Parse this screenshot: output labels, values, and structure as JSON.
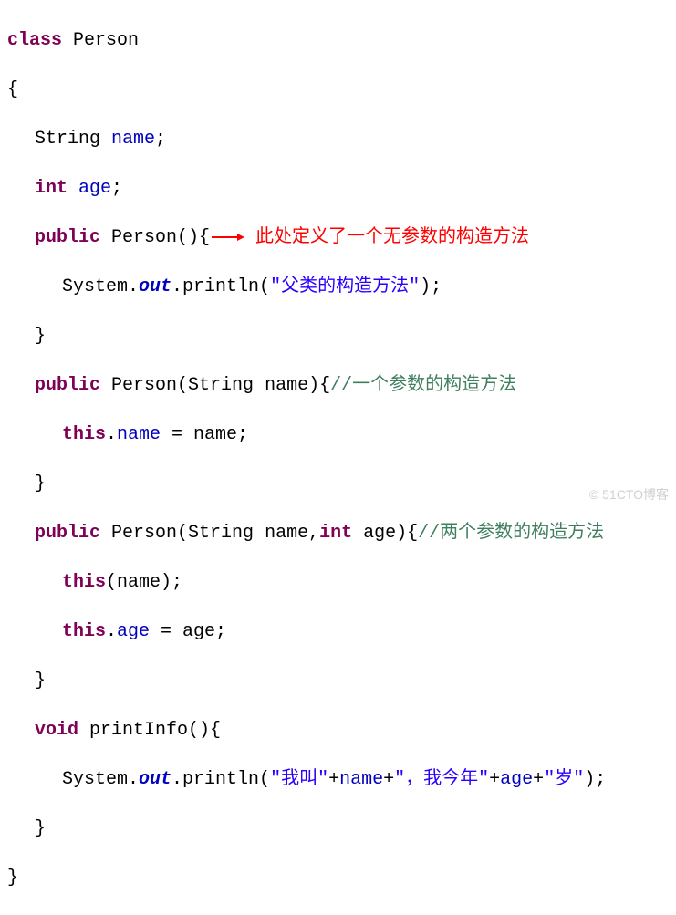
{
  "code": {
    "l1_kw": "class",
    "l1_name": " Person",
    "l2": "{",
    "l3_type": "String",
    "l3_var": " name",
    "l3_semi": ";",
    "l4_type": "int",
    "l4_var": " age",
    "l4_semi": ";",
    "l5_kw": "public",
    "l5_name": " Person",
    "l5_paren": "(){",
    "l5_anno": " 此处定义了一个无参数的构造方法",
    "l6_sys": "System.",
    "l6_out": "out",
    "l6_print": ".println(",
    "l6_str": "\"父类的构造方法\"",
    "l6_end": ");",
    "l7": "}",
    "l8_kw": "public",
    "l8_name": " Person",
    "l8_paren_open": "(String name){",
    "l8_paren_open_pre": "(",
    "l8_param_type": "String",
    "l8_param_name": " name",
    "l8_paren_close": "){",
    "l8_comment": "//一个参数的构造方法",
    "l9_this": "this",
    "l9_dot": ".",
    "l9_name": "name",
    "l9_assign": " = name;",
    "l10": "}",
    "l11_kw": "public",
    "l11_name": " Person",
    "l11_paren_open": "(",
    "l11_param1_type": "String",
    "l11_param1_name": " name,",
    "l11_param2_type": "int",
    "l11_param2_name": " age",
    "l11_paren_close": "){",
    "l11_comment": "//两个参数的构造方法",
    "l12_this": "this",
    "l12_rest": "(name);",
    "l13_this": "this",
    "l13_dot": ".",
    "l13_age": "age",
    "l13_assign": " = age;",
    "l14": "}",
    "l15_kw": "void",
    "l15_name": " printInfo",
    "l15_paren": "(){",
    "l16_sys": "System.",
    "l16_out": "out",
    "l16_print": ".println(",
    "l16_s1": "\"我叫\"",
    "l16_p1": "+",
    "l16_v1": "name",
    "l16_p2": "+",
    "l16_s2": "\"，我今年\"",
    "l16_p3": "+",
    "l16_v2": "age",
    "l16_p4": "+",
    "l16_s3": "\"岁\"",
    "l16_end": ");",
    "l17": "}",
    "l18": "}"
  },
  "watermark": "© 51CTO博客"
}
